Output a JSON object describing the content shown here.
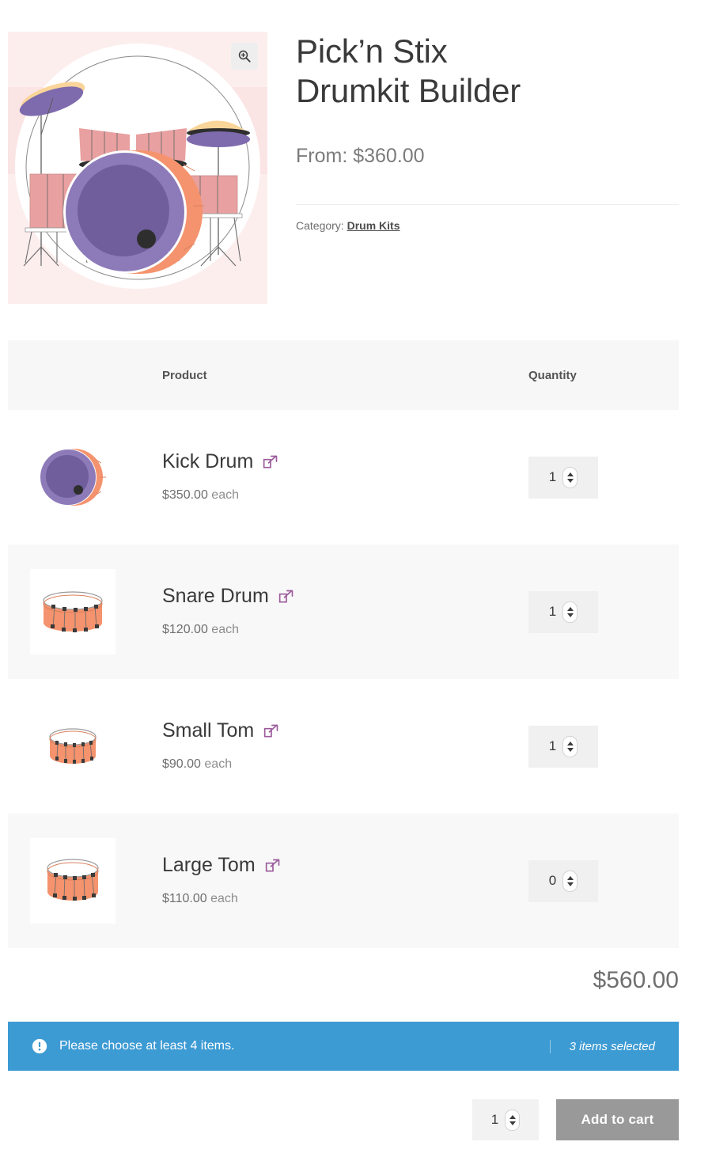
{
  "product": {
    "title_line1": "Pick’n Stix",
    "title_line2": "Drumkit Builder",
    "price_from": "From: $360.00",
    "category_label": "Category:",
    "category_value": "Drum Kits",
    "gallery_zoom_icon": "magnifier-zoom-in-icon",
    "gallery_image_alt": "drum-kit-illustration"
  },
  "table": {
    "headers": {
      "product": "Product",
      "quantity": "Quantity"
    },
    "rows": [
      {
        "name": "Kick Drum",
        "price": "$350.00",
        "unit": "each",
        "quantity": "1",
        "thumb_icon": "kick-drum-thumbnail",
        "link_icon": "external-link-icon"
      },
      {
        "name": "Snare Drum",
        "price": "$120.00",
        "unit": "each",
        "quantity": "1",
        "thumb_icon": "snare-drum-thumbnail",
        "link_icon": "external-link-icon"
      },
      {
        "name": "Small Tom",
        "price": "$90.00",
        "unit": "each",
        "quantity": "1",
        "thumb_icon": "small-tom-thumbnail",
        "link_icon": "external-link-icon"
      },
      {
        "name": "Large Tom",
        "price": "$110.00",
        "unit": "each",
        "quantity": "0",
        "thumb_icon": "large-tom-thumbnail",
        "link_icon": "external-link-icon"
      }
    ]
  },
  "total": "$560.00",
  "notice": {
    "icon": "exclamation-circle-icon",
    "message": "Please choose at least 4 items.",
    "count_text": "3 items selected"
  },
  "cart": {
    "quantity": "1",
    "button_label": "Add to cart"
  },
  "colors": {
    "notice_background": "#3d9bd4",
    "add_to_cart_background": "#999999",
    "external_link": "#9c5b9c",
    "gallery_background": "#fdeeee",
    "drum_orange": "#f4936d",
    "drum_purple": "#7e6bad",
    "table_header_background": "#f7f7f7",
    "row_alt_background": "#f8f8f8"
  }
}
